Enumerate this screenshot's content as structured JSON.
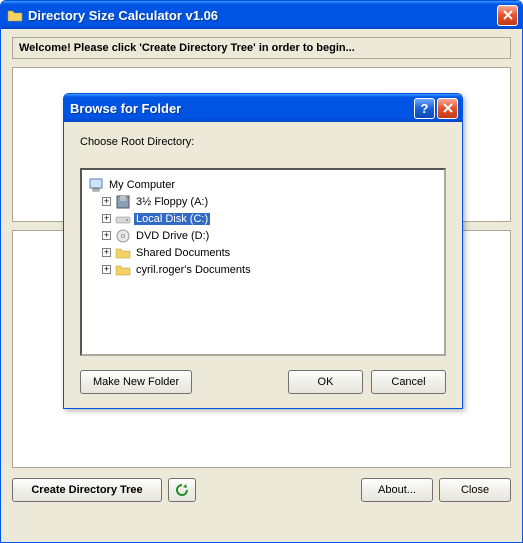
{
  "main": {
    "title": "Directory Size Calculator v1.06",
    "welcome": "Welcome! Please click 'Create Directory Tree' in order to begin...",
    "buttons": {
      "create": "Create Directory Tree",
      "about": "About...",
      "close": "Close"
    }
  },
  "dialog": {
    "title": "Browse for Folder",
    "label": "Choose Root Directory:",
    "tree": {
      "root": "My Computer",
      "items": [
        {
          "label": "3½ Floppy (A:)",
          "icon": "floppy",
          "selected": false
        },
        {
          "label": "Local Disk (C:)",
          "icon": "disk",
          "selected": true
        },
        {
          "label": "DVD Drive (D:)",
          "icon": "cd",
          "selected": false
        },
        {
          "label": "Shared Documents",
          "icon": "folder",
          "selected": false
        },
        {
          "label": "cyril.roger's Documents",
          "icon": "folder",
          "selected": false
        }
      ]
    },
    "buttons": {
      "makeNew": "Make New Folder",
      "ok": "OK",
      "cancel": "Cancel"
    }
  }
}
